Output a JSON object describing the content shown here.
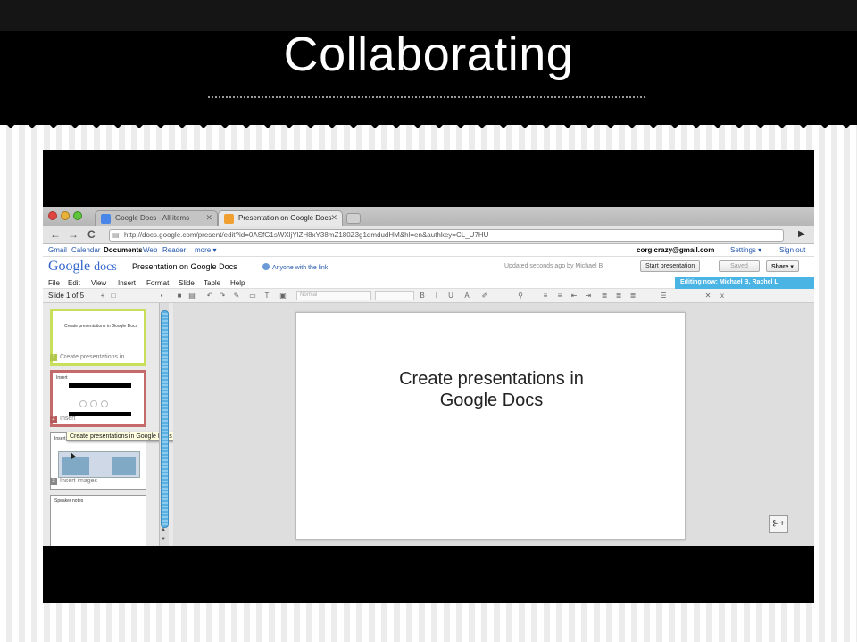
{
  "slide": {
    "title": "Collaborating"
  },
  "browser": {
    "tabs": [
      {
        "label": "Google Docs - All items"
      },
      {
        "label": "Presentation on Google Docs"
      }
    ],
    "url": "http://docs.google.com/present/edit?id=0ASfG1sWXljYlZH8xY38mZ180Z3g1dmdudHM&hl=en&authkey=CL_U7HU"
  },
  "gbar": {
    "links": [
      "Gmail",
      "Calendar",
      "Documents",
      "Web",
      "Reader",
      "more ▾"
    ],
    "account": "corgicrazy@gmail.com",
    "settings": "Settings ▾",
    "signout": "Sign out"
  },
  "doc": {
    "logo_google": "Google",
    "logo_docs": "docs",
    "title": "Presentation on Google Docs",
    "share_note": "Anyone with the link",
    "updated": "Updated seconds ago by Michael B",
    "start_button": "Start presentation",
    "saved_button": "Saved",
    "share_button": "Share",
    "editing_now": "Editing now: Michael B, Rachel L"
  },
  "menu": [
    "File",
    "Edit",
    "View",
    "Insert",
    "Format",
    "Slide",
    "Table",
    "Help"
  ],
  "toolbar": {
    "slide_count": "Slide 1 of 5",
    "font": "Normal"
  },
  "thumbnails": [
    {
      "title": "",
      "body": "Create presentations in Google Docs",
      "label": "Create presentations in"
    },
    {
      "title": "Insert",
      "body": "",
      "label": "Insert"
    },
    {
      "title": "Insert images",
      "body": "",
      "label": "Insert images"
    },
    {
      "title": "Speaker notes",
      "body": "",
      "label": ""
    }
  ],
  "tooltip": "Create presentations in Google Docs",
  "canvas": {
    "line1": "Create presentations in",
    "line2": "Google Docs"
  },
  "icons": {
    "notes": "speaker-notes-icon"
  }
}
